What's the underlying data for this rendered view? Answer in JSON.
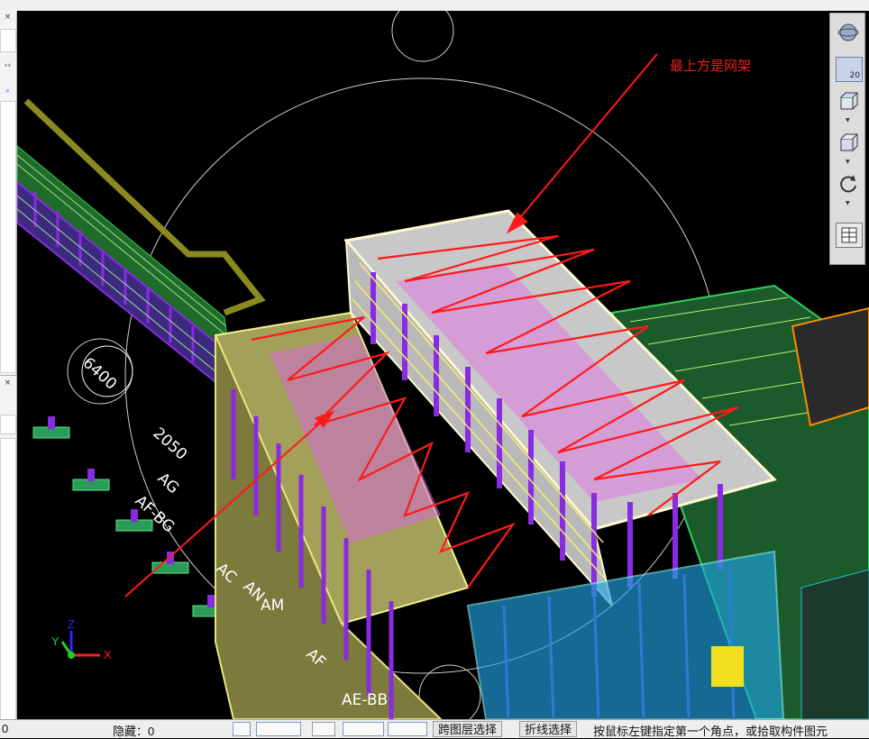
{
  "annotation": {
    "text": "最上方是网架"
  },
  "panel_markers": {
    "close_top": "×",
    "close_mid": "×",
    "expand": "››"
  },
  "nav_toolbar": {
    "zoom_label": "20"
  },
  "axis": {
    "x": "X",
    "y": "Y",
    "z": "Z"
  },
  "dimension_labels": [
    "6400",
    "2050",
    "AG",
    "AF-BG",
    "AC",
    "AN",
    "AM",
    "AF",
    "AE-BB"
  ],
  "statusbar": {
    "left_value": "0",
    "hidden_label": "隐藏：0",
    "cross_layer_select": "跨图层选择",
    "polyline_select": "折线选择",
    "hint": "按鼠标左键指定第一个角点，或拾取构件图元"
  },
  "colors": {
    "annotation": "#e8221b",
    "background": "#000000",
    "structure_purple": "#8a2be2",
    "structure_green": "#2dd35a",
    "glass": "#1fa3e0"
  }
}
